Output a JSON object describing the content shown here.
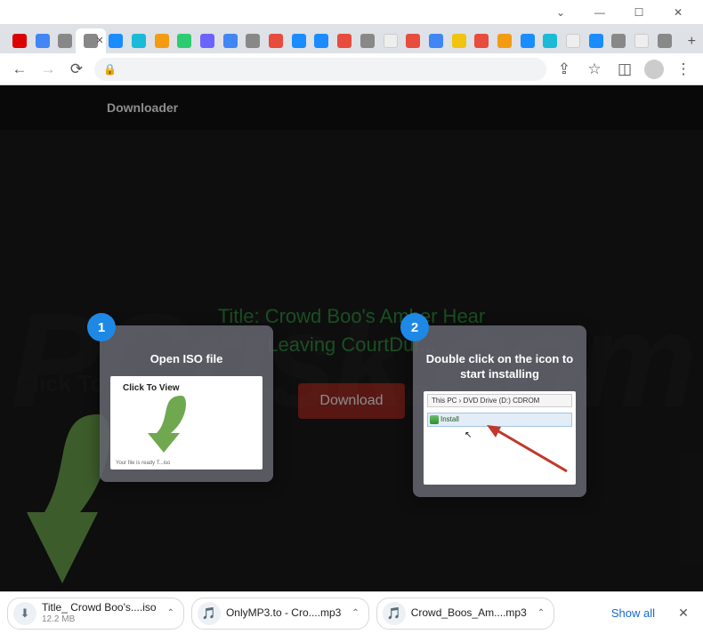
{
  "window_controls": {
    "dropdown": "⌄",
    "min": "—",
    "max": "☐",
    "close": "✕"
  },
  "tabs": {
    "favicons": [
      "yt",
      "go",
      "gr",
      "gr",
      "bl",
      "cy",
      "or",
      "gn",
      "pu",
      "go",
      "gr",
      "rd",
      "bl",
      "bl",
      "rd",
      "gr",
      "wt",
      "rd",
      "go",
      "yl",
      "rd",
      "or",
      "bl",
      "cy",
      "wt",
      "bl",
      "gr",
      "wt",
      "gr"
    ],
    "active_index": 3,
    "close_glyph": "✕",
    "new_tab": "+"
  },
  "addressbar": {
    "back": "←",
    "forward": "→",
    "reload": "⟳",
    "lock": "🔒",
    "url": "",
    "share": "⇪",
    "star": "☆",
    "ext": "◫",
    "avatar": "",
    "menu": "⋮"
  },
  "page": {
    "brand": "Downloader",
    "title": "Title: Crowd Boo's Amber Hear Leaving CourtDur...",
    "download_label": "Download",
    "watermark": "PCrisk.com",
    "click_to_view": "Click To View"
  },
  "popover1": {
    "badge": "1",
    "text": "Open ISO file",
    "thumb_label": "Click To View",
    "thumb_foot": "Your file is ready T...iso"
  },
  "popover2": {
    "badge": "2",
    "text": "Double click on the icon to start installing",
    "crumb": "This PC  ›  DVD Drive (D:) CDROM",
    "install_label": "Install"
  },
  "shelf": {
    "items": [
      {
        "icon": "⬇",
        "name": "Title_ Crowd Boo's....iso",
        "size": "12.2 MB"
      },
      {
        "icon": "🎵",
        "name": "OnlyMP3.to - Cro....mp3",
        "size": ""
      },
      {
        "icon": "🎵",
        "name": "Crowd_Boos_Am....mp3",
        "size": ""
      }
    ],
    "chevron": "⌃",
    "show_all": "Show all",
    "close": "✕"
  }
}
